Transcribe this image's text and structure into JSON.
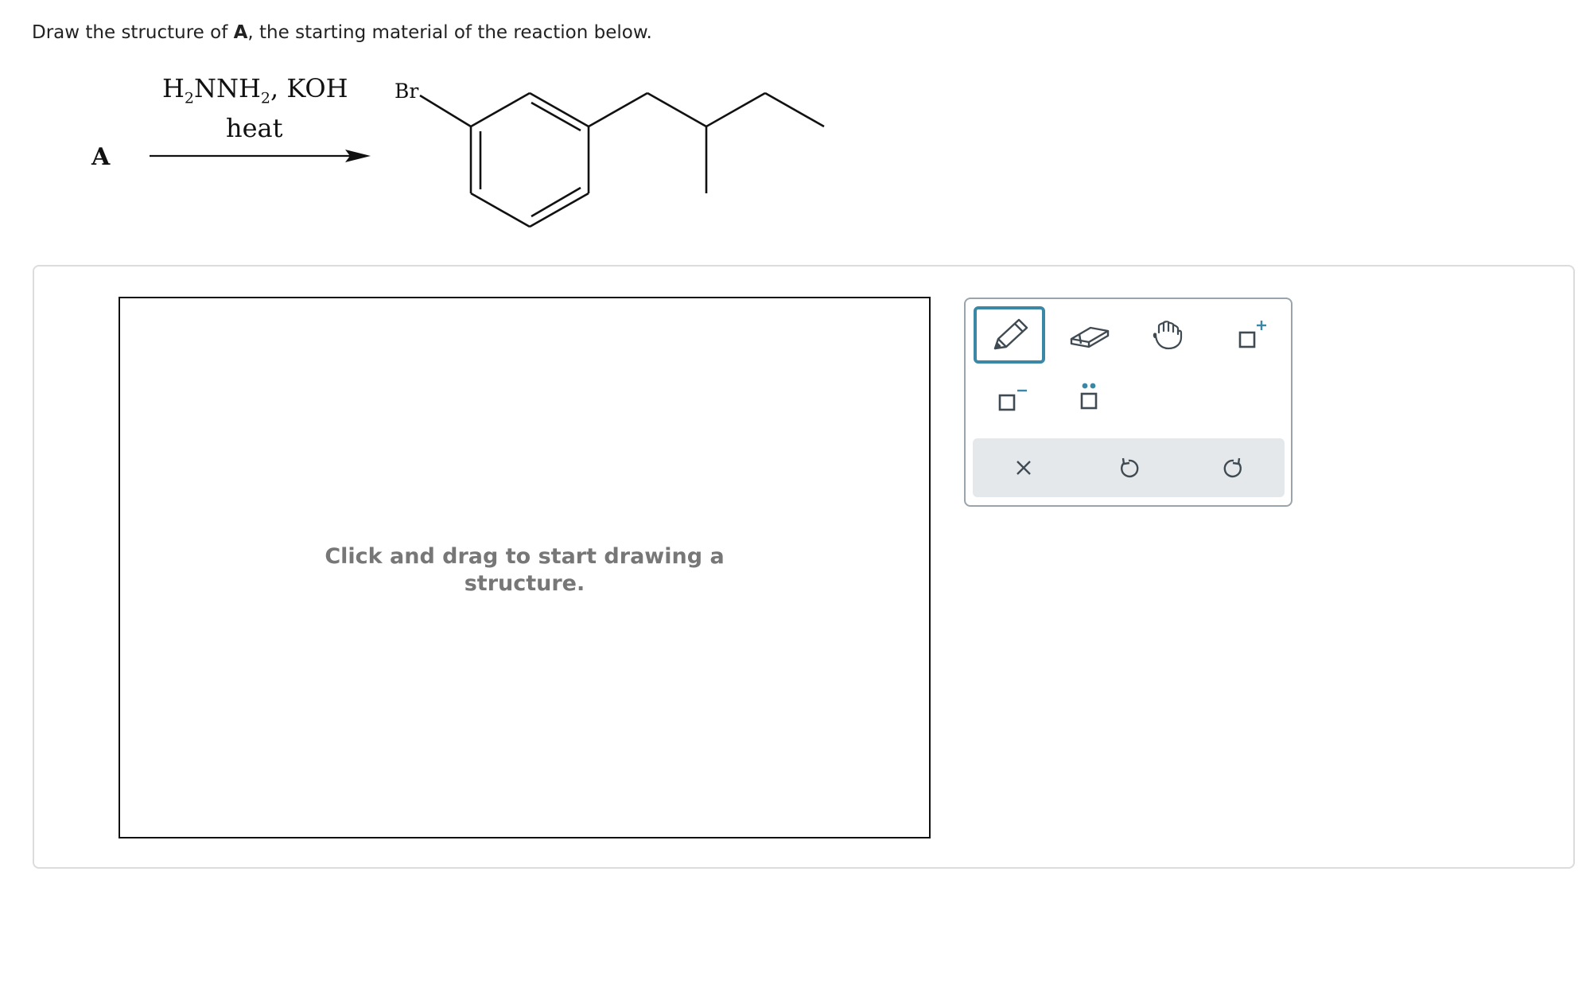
{
  "question": {
    "prefix": "Draw the structure of ",
    "bold": "A",
    "suffix": ", the starting material of the reaction below."
  },
  "reaction": {
    "reactant_label": "A",
    "reagent_1_H": "H",
    "reagent_1_sub1": "2",
    "reagent_1_mid": "NNH",
    "reagent_1_sub2": "2",
    "reagent_1_end": ", KOH",
    "conditions": "heat",
    "product_substituent": "Br"
  },
  "canvas": {
    "hint_line1": "Click and drag to start drawing a",
    "hint_line2": "structure."
  },
  "toolbar": {
    "tools": [
      "pencil-icon",
      "eraser-icon",
      "hand-icon",
      "add-charge-icon",
      "remove-charge-icon",
      "lone-pair-icon"
    ],
    "actions": [
      "clear-icon",
      "undo-icon",
      "redo-icon"
    ],
    "active_tool": "pencil-icon",
    "accent_color": "#3a87a6",
    "icon_color": "#3f4a52"
  }
}
